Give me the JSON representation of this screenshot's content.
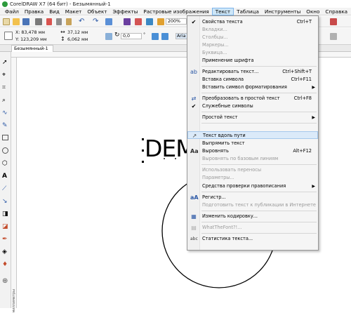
{
  "window": {
    "title": "CorelDRAW X7 (64 бит) - Безымянный-1"
  },
  "menubar": {
    "items": [
      "Файл",
      "Правка",
      "Вид",
      "Макет",
      "Объект",
      "Эффекты",
      "Растровые изображения",
      "Текст",
      "Таблица",
      "Инструменты",
      "Окно",
      "Справка"
    ],
    "active_index": 7
  },
  "toolbar": {
    "zoom": "200%"
  },
  "propbar": {
    "x": "X: 83,478 мм",
    "y": "Y: 123,209 мм",
    "width": "37,12 мм",
    "height": "6,062 мм",
    "angle": "0,0",
    "deg": "°",
    "font_partial": "Aria"
  },
  "tab": {
    "label": "Безымянный-1"
  },
  "ruler_left_label": "миллиметры",
  "canvas": {
    "text": "DEM"
  },
  "menu": {
    "items": [
      {
        "label": "Свойства текста",
        "shortcut": "Ctrl+T",
        "icon": "check-icon",
        "disabled": false
      },
      {
        "label": "Вкладки...",
        "shortcut": "",
        "icon": "",
        "disabled": true
      },
      {
        "label": "Столбцы...",
        "shortcut": "",
        "icon": "",
        "disabled": true
      },
      {
        "label": "Маркеры...",
        "shortcut": "",
        "icon": "",
        "disabled": true
      },
      {
        "label": "Буквица...",
        "shortcut": "",
        "icon": "",
        "disabled": true
      },
      {
        "label": "Применение шрифта",
        "shortcut": "",
        "icon": "",
        "disabled": false
      },
      {
        "label": "Редактировать текст...",
        "shortcut": "Ctrl+Shift+T",
        "icon": "edit-text-icon",
        "disabled": false
      },
      {
        "label": "Вставка символа",
        "shortcut": "Ctrl+F11",
        "icon": "",
        "disabled": false
      },
      {
        "label": "Вставить символ форматирования",
        "shortcut": "",
        "icon": "",
        "disabled": false,
        "submenu": true
      },
      {
        "label": "Преобразовать в простой текст",
        "shortcut": "Ctrl+F8",
        "icon": "convert-icon",
        "disabled": false
      },
      {
        "label": "Служебные символы",
        "shortcut": "",
        "icon": "check-icon",
        "disabled": false
      },
      {
        "label": "Простой текст",
        "shortcut": "",
        "icon": "",
        "disabled": false,
        "submenu": true
      },
      {
        "label": "Текст вдоль пути",
        "shortcut": "",
        "icon": "text-path-icon",
        "disabled": false,
        "highlighted": true
      },
      {
        "label": "Выпрямить текст",
        "shortcut": "",
        "icon": "",
        "disabled": false
      },
      {
        "label": "Выровнять",
        "shortcut": "Alt+F12",
        "icon": "align-icon",
        "disabled": false
      },
      {
        "label": "Выровнять по базовым линиям",
        "shortcut": "",
        "icon": "",
        "disabled": true
      },
      {
        "label": "Использовать переносы",
        "shortcut": "",
        "icon": "",
        "disabled": true
      },
      {
        "label": "Параметры...",
        "shortcut": "",
        "icon": "",
        "disabled": true
      },
      {
        "label": "Средства проверки правописания",
        "shortcut": "",
        "icon": "",
        "disabled": false,
        "submenu": true
      },
      {
        "label": "Регистр...",
        "shortcut": "",
        "icon": "case-icon",
        "disabled": false
      },
      {
        "label": "Подготовить текст к публикации в Интернете",
        "shortcut": "",
        "icon": "",
        "disabled": true
      },
      {
        "label": "Изменить кодировку...",
        "shortcut": "",
        "icon": "encoding-icon",
        "disabled": false
      },
      {
        "label": "WhatTheFont?!...",
        "shortcut": "",
        "icon": "whatthefont-icon",
        "disabled": true
      },
      {
        "label": "Статистика текста...",
        "shortcut": "",
        "icon": "statistics-icon",
        "disabled": false
      }
    ]
  }
}
